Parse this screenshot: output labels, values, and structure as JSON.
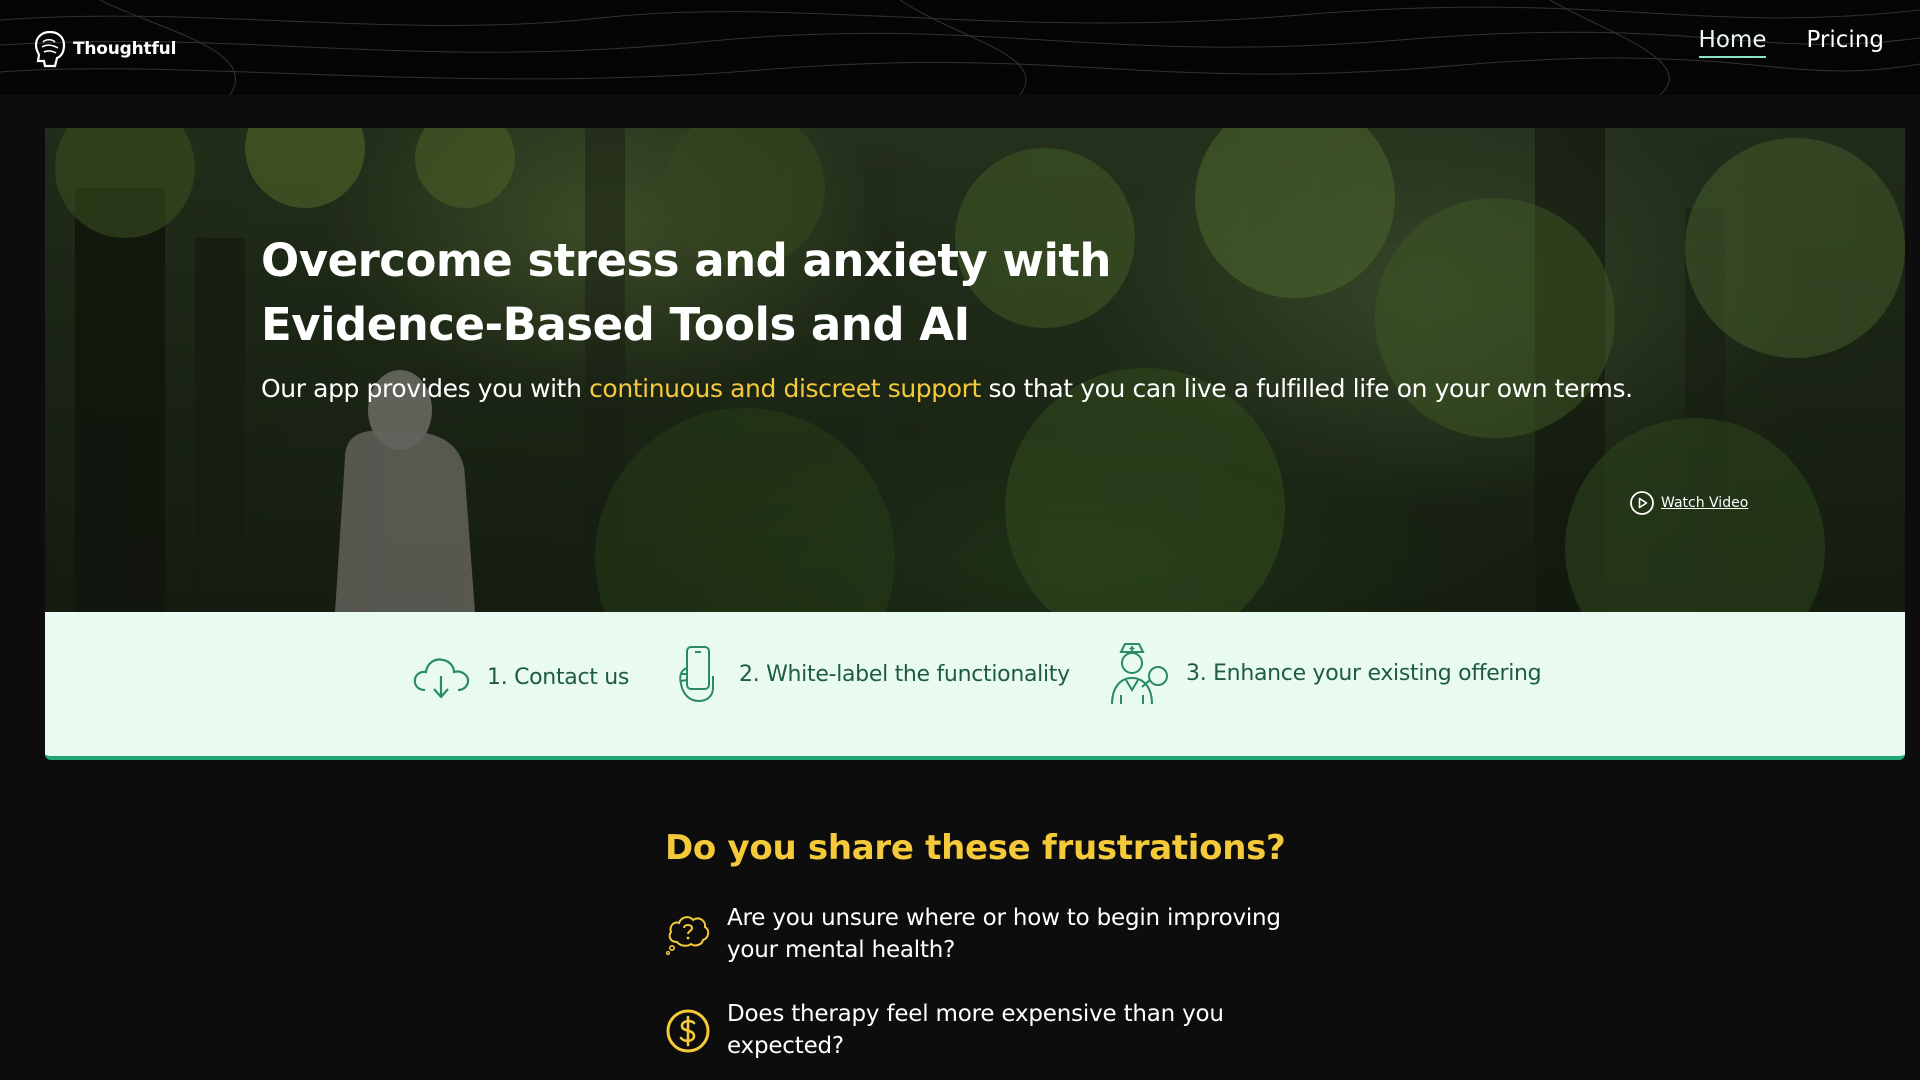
{
  "header": {
    "brand_name": "Thoughtful",
    "nav": [
      {
        "label": "Home",
        "active": true
      },
      {
        "label": "Pricing",
        "active": false
      }
    ]
  },
  "hero": {
    "title_line1": "Overcome stress and anxiety with",
    "title_line2": "Evidence-Based Tools and AI",
    "subtitle_before": "Our app provides you with ",
    "subtitle_highlight": "continuous and discreet support",
    "subtitle_after": " so that you can live a fulfilled life on your own terms.",
    "watch_video_label": "Watch Video",
    "highlight_color": "#f4c93a"
  },
  "steps": [
    {
      "label": "1. Contact us",
      "icon": "cloud-download-icon"
    },
    {
      "label": "2. White-label the functionality",
      "icon": "hand-phone-icon"
    },
    {
      "label": "3. Enhance your existing offering",
      "icon": "nurse-icon"
    }
  ],
  "frustrations": {
    "title": "Do you share these frustrations?",
    "items": [
      {
        "text": "Are you unsure where or how to begin improving your mental health?",
        "icon": "question-thought-icon"
      },
      {
        "text": "Does therapy feel more expensive than you expected?",
        "icon": "dollar-coin-icon"
      }
    ]
  },
  "colors": {
    "accent_yellow": "#f4c93a",
    "steps_bg": "#e9fbf1",
    "steps_text": "#1e5b44",
    "steps_border": "#1fa876"
  }
}
